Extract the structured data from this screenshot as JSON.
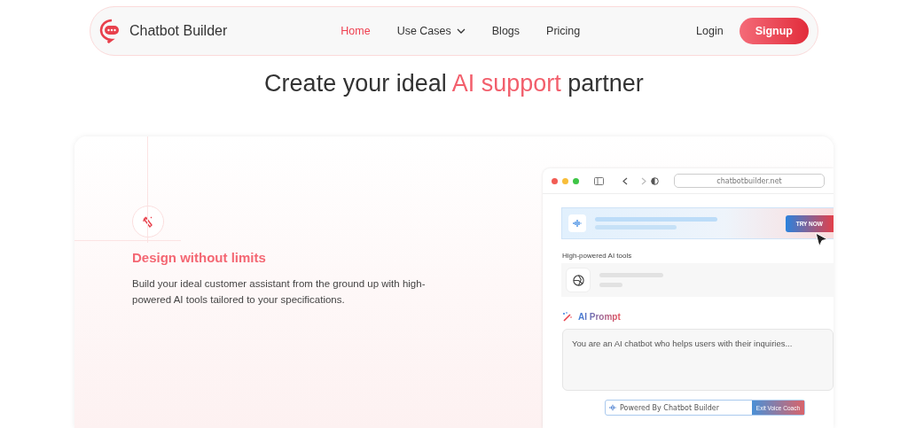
{
  "nav": {
    "brand": "Chatbot Builder",
    "items": [
      {
        "label": "Home",
        "selected": true,
        "dropdown": false
      },
      {
        "label": "Use Cases",
        "selected": false,
        "dropdown": true
      },
      {
        "label": "Blogs",
        "selected": false,
        "dropdown": false
      },
      {
        "label": "Pricing",
        "selected": false,
        "dropdown": false
      }
    ],
    "login": "Login",
    "signup": "Signup"
  },
  "hero": {
    "title_before": "Create your ideal ",
    "title_highlight": "AI support",
    "title_after": " partner"
  },
  "feature": {
    "title": "Design without limits",
    "text": "Build your ideal customer assistant from the ground up with high-powered AI tools tailored to your specifications."
  },
  "browser": {
    "url": "chatbotbuilder.net",
    "try_button": "TRY NOW",
    "tools_label": "High-powered AI tools",
    "prompt_label": "AI Prompt",
    "prompt_text": "You are an AI chatbot who helps users with their inquiries...",
    "powered": "Powered By Chatbot Builder",
    "exit_button": "Exit Voice Coach"
  }
}
